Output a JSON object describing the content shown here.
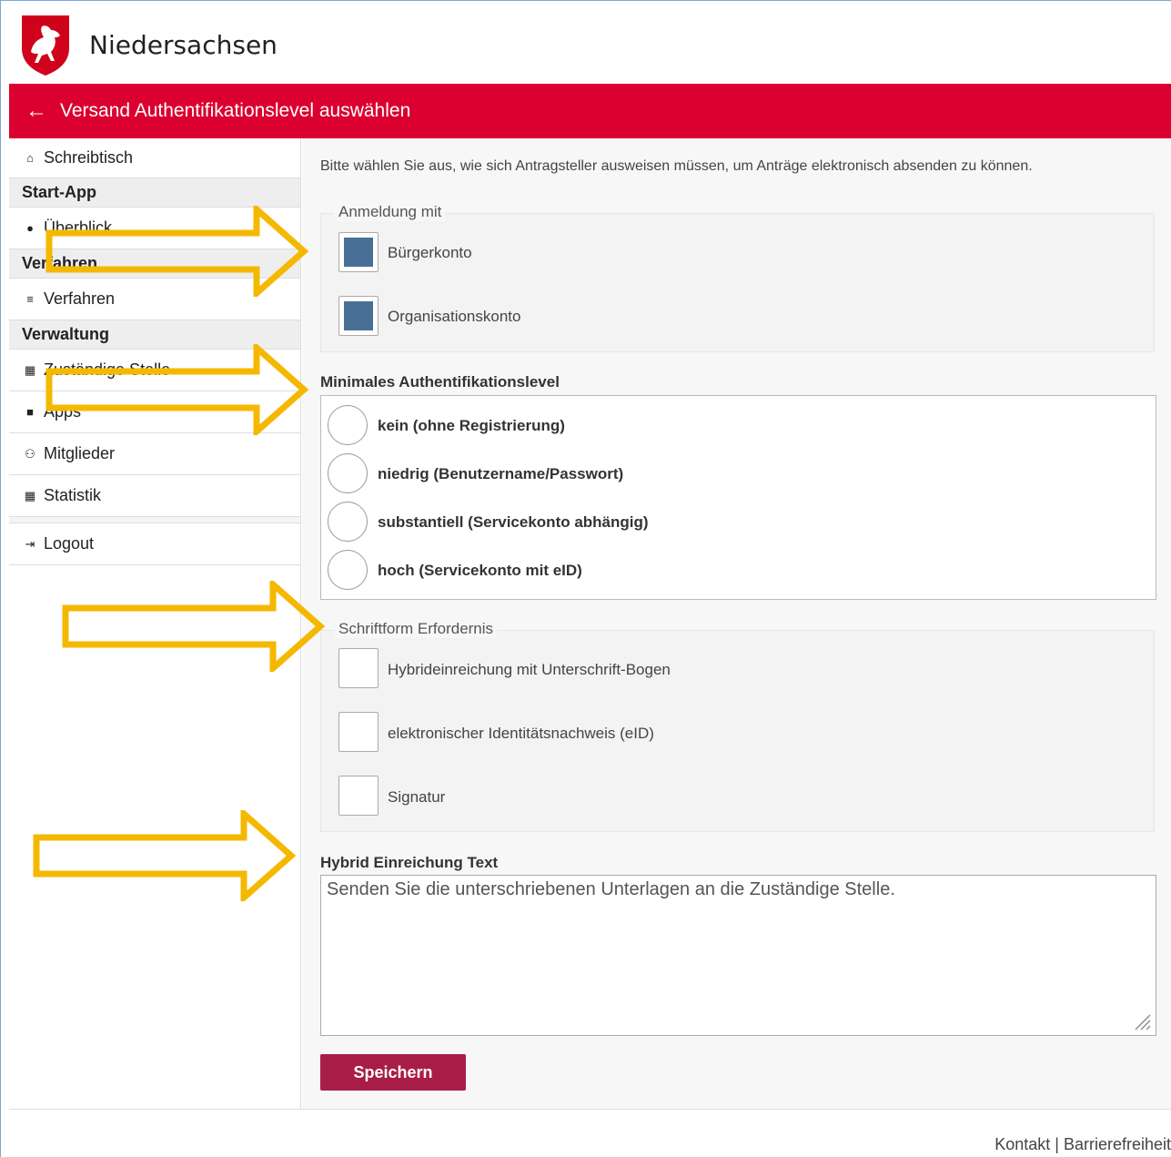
{
  "header": {
    "brand": "Niedersachsen",
    "logo_icon": "horse-crest-icon"
  },
  "titlebar": {
    "back_icon": "←",
    "title": "Versand Authentifikationslevel auswählen",
    "color": "#dc0030"
  },
  "sidebar": {
    "items": [
      {
        "type": "item",
        "icon": "⌂",
        "label": "Schreibtisch"
      },
      {
        "type": "head",
        "label": "Start-App"
      },
      {
        "type": "item",
        "icon": "●",
        "label": "Überblick"
      },
      {
        "type": "head",
        "label": "Verfahren"
      },
      {
        "type": "item",
        "icon": "≡",
        "label": "Verfahren"
      },
      {
        "type": "head",
        "label": "Verwaltung"
      },
      {
        "type": "item",
        "icon": "▦",
        "label": "Zuständige Stelle"
      },
      {
        "type": "item",
        "icon": "■",
        "label": "Apps"
      },
      {
        "type": "item",
        "icon": "⚇",
        "label": "Mitglieder"
      },
      {
        "type": "item",
        "icon": "▦",
        "label": "Statistik"
      },
      {
        "type": "item",
        "icon": "⇥",
        "label": "Logout"
      }
    ]
  },
  "main": {
    "intro": "Bitte wählen Sie aus, wie sich Antragsteller ausweisen müssen, um Anträge elektronisch absenden zu können.",
    "anmeldung": {
      "legend": "Anmeldung mit",
      "options": [
        {
          "label": "Bürgerkonto",
          "checked": true
        },
        {
          "label": "Organisationskonto",
          "checked": true
        }
      ]
    },
    "authlevel": {
      "title": "Minimales Authentifikationslevel",
      "options": [
        "kein (ohne Registrierung)",
        "niedrig (Benutzername/Passwort)",
        "substantiell (Servicekonto abhängig)",
        "hoch (Servicekonto mit eID)"
      ]
    },
    "schriftform": {
      "legend": "Schriftform Erfordernis",
      "options": [
        {
          "label": "Hybrideinreichung mit Unterschrift-Bogen",
          "checked": false
        },
        {
          "label": "elektronischer Identitätsnachweis (eID)",
          "checked": false
        },
        {
          "label": "Signatur",
          "checked": false
        }
      ]
    },
    "hybrid": {
      "title": "Hybrid Einreichung Text",
      "value": "Senden Sie die unterschriebenen Unterlagen an die Zuständige Stelle."
    },
    "save_label": "Speichern"
  },
  "footer": {
    "links": "Kontakt | Barrierefreiheit"
  },
  "colors": {
    "accent": "#dc0030",
    "button": "#a81c48",
    "checkbox_fill": "#4a6f96",
    "annotation_arrow": "#f5b800"
  }
}
